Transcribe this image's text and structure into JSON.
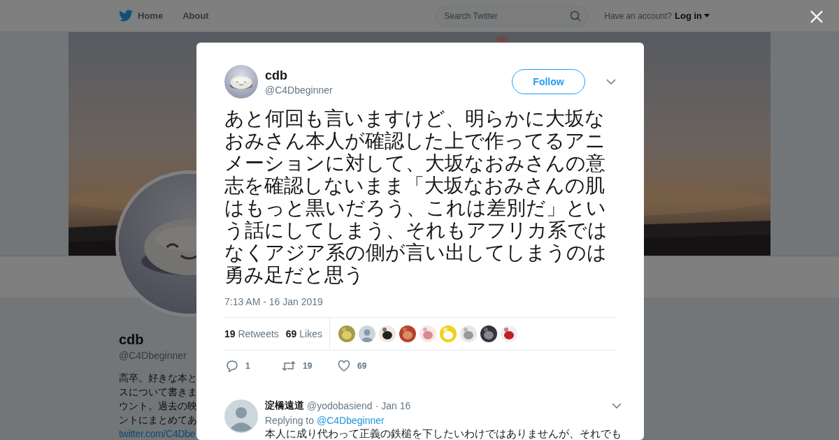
{
  "nav": {
    "items": [
      {
        "label": "Home",
        "kind": "logo"
      },
      {
        "label": "About",
        "kind": "text"
      }
    ],
    "search": {
      "placeholder": "Search Twitter"
    },
    "account_prompt": "Have an account?",
    "login": "Log in"
  },
  "profile": {
    "name": "cdb",
    "handle": "@C4Dbeginner",
    "bio_lines": [
      "高卒。好きな本と",
      "スについて書きま",
      "ウント。過去の映",
      "ントにまとめてあ"
    ],
    "link": "twitter.com/C4Dbe"
  },
  "tweet": {
    "name": "cdb",
    "handle": "@C4Dbeginner",
    "follow": "Follow",
    "text": "あと何回も言いますけど、明らかに大坂なおみさん本人が確認した上で作ってるアニメーションに対して、大坂なおみさんの意志を確認しないまま「大坂なおみさんの肌はもっと黒いだろう、これは差別だ」という話にしてしまう、それもアフリカ系ではなくアジア系の側が言い出してしまうのは勇み足だと思う",
    "time": "7:13 AM - 16 Jan 2019",
    "stats": [
      {
        "count": "19",
        "label": "Retweets"
      },
      {
        "count": "69",
        "label": "Likes"
      }
    ],
    "liked_by": [
      {
        "kind": "picture"
      },
      {
        "kind": "default"
      },
      {
        "kind": "picture"
      },
      {
        "kind": "picture"
      },
      {
        "kind": "picture"
      },
      {
        "kind": "picture"
      },
      {
        "kind": "picture"
      },
      {
        "kind": "picture"
      },
      {
        "kind": "picture"
      }
    ],
    "actions": [
      {
        "kind": "reply",
        "count": "1"
      },
      {
        "kind": "retweet",
        "count": "19"
      },
      {
        "kind": "like",
        "count": "69"
      }
    ]
  },
  "reply": {
    "name": "淀橋遠道",
    "handle": "@yodobasiend",
    "date": "· Jan 16",
    "replying_to": "Replying to",
    "mention": "@C4Dbeginner",
    "text": "本人に成り代わって正義の鉄槌を下したいわけではありませんが、それでも"
  }
}
